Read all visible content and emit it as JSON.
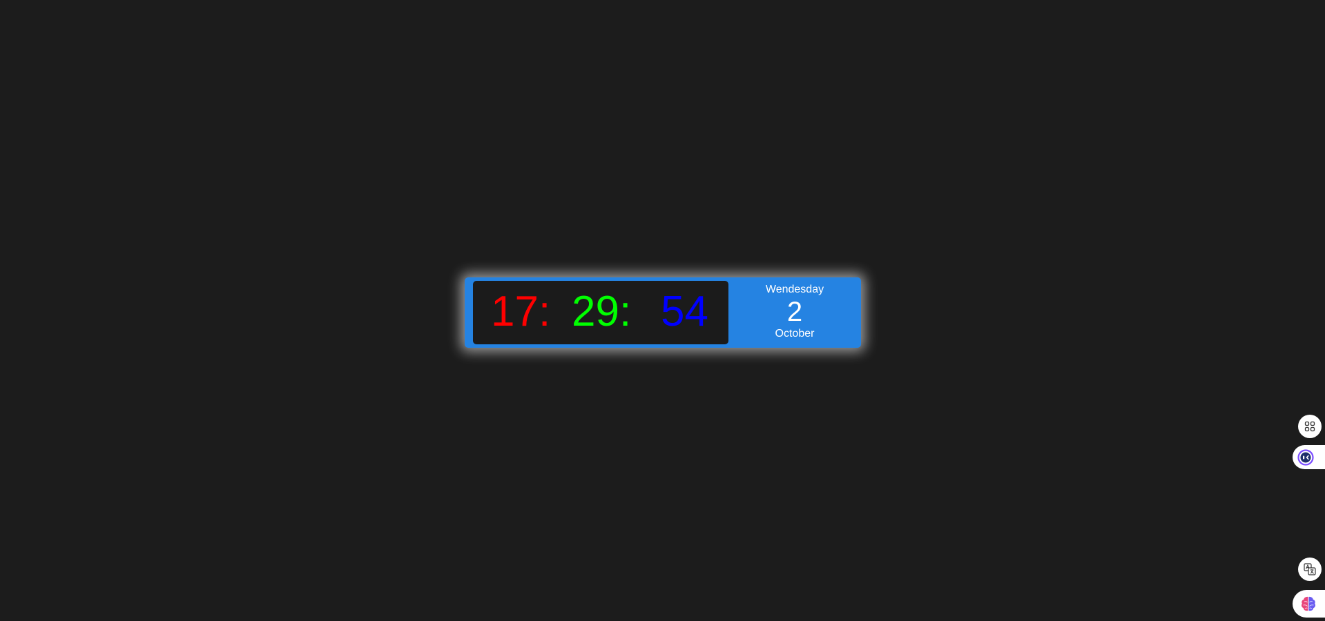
{
  "clock": {
    "hours": "17:",
    "minutes": "29:",
    "seconds": "54",
    "weekday": "Wendesday",
    "day": "2",
    "month": "October"
  },
  "colors": {
    "background": "#1c1c1c",
    "widget": "#2583e2",
    "time_panel": "#1b1b1b",
    "hours": "#ff0000",
    "minutes": "#00ff00",
    "seconds": "#0000ff"
  },
  "side_toolbar": {
    "icons": [
      "apps-grid-icon",
      "assistant-face-icon",
      "translate-icon",
      "brain-icon"
    ]
  }
}
